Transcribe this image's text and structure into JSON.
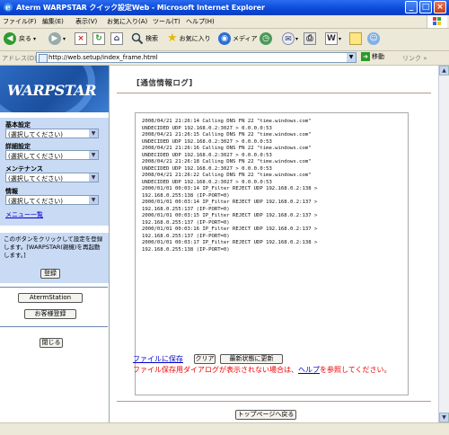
{
  "window": {
    "title": "Aterm WARPSTAR クイック設定Web - Microsoft Internet Explorer"
  },
  "menubar": [
    "ファイル(F)",
    "編集(E)",
    "表示(V)",
    "お気に入り(A)",
    "ツール(T)",
    "ヘルプ(H)"
  ],
  "toolbar": {
    "back": "戻る",
    "search": "検索",
    "favorites": "お気に入り",
    "media": "メディア"
  },
  "address": {
    "label": "アドレス(D)",
    "url": "http://web.setup/index_frame.html",
    "go": "移動",
    "links": "リンク"
  },
  "sidebar": {
    "logo_text": "WARPSTAR",
    "sections": [
      {
        "label": "基本設定",
        "select": "(選択してください)"
      },
      {
        "label": "詳細設定",
        "select": "(選択してください)"
      },
      {
        "label": "メンテナンス",
        "select": "(選択してください)"
      },
      {
        "label": "情報",
        "select": "(選択してください)"
      }
    ],
    "menu_list_link": "メニュー一覧",
    "restart_message": "このボタンをクリックして設定を登録します。[WARPSTAR(親機)を再起動します。]",
    "register_button": "登録",
    "aterm_station_button": "AtermStation",
    "favorites_button": "お客様登録",
    "close_button": "閉じる"
  },
  "content": {
    "heading": "[通信情報ログ]",
    "log_lines": [
      "2008/04/21 21:26:14 Calling DNS FN 22 \"time.windows.com\"",
      "UNDECIDED UDP 192.168.0.2:3027 > 0.0.0.0:53",
      "2008/04/21 21:26:15 Calling DNS FN 22 \"time.windows.com\"",
      "UNDECIDED UDP 192.168.0.2:3027 > 0.0.0.0:53",
      "2008/04/21 21:26:16 Calling DNS FN 22 \"time.windows.com\"",
      "UNDECIDED UDP 192.168.0.2:3027 > 0.0.0.0:53",
      "2008/04/21 21:26:18 Calling DNS FN 22 \"time.windows.com\"",
      "UNDECIDED UDP 192.168.0.2:3027 > 0.0.0.0:53",
      "2008/04/21 21:26:22 Calling DNS FN 22 \"time.windows.com\"",
      "UNDECIDED UDP 192.168.0.2:3027 > 0.0.0.0:53",
      "2000/01/01 00:03:14 IP_Filter REJECT UDP 192.168.0.2:138 >",
      "192.168.0.255:138 (IP-PORT=0)",
      "2000/01/01 00:03:14 IP_Filter REJECT UDP 192.168.0.2:137 >",
      "192.168.0.255:137 (IP-PORT=0)",
      "2000/01/01 00:03:15 IP_Filter REJECT UDP 192.168.0.2:137 >",
      "192.168.0.255:137 (IP-PORT=0)",
      "2000/01/01 00:03:16 IP_Filter REJECT UDP 192.168.0.2:137 >",
      "192.168.0.255:137 (IP-PORT=0)",
      "2000/01/01 00:03:17 IP_Filter REJECT UDP 192.168.0.2:138 >",
      "192.168.0.255:138 (IP-PORT=0)"
    ],
    "save_link": "ファイルに保存",
    "clear_button": "クリア",
    "refresh_button": "最新状態に更新",
    "warning_before": "ファイル保存用ダイアログが表示されない場合は、",
    "warning_link": "ヘルプ",
    "warning_after": "を参照してください。",
    "top_button": "トップページへ戻る"
  },
  "colors": {
    "titlebar": "#0b48d8",
    "sidebar_panel": "#c9daf4",
    "warning_text": "#ee0000",
    "link": "#0000cc"
  }
}
